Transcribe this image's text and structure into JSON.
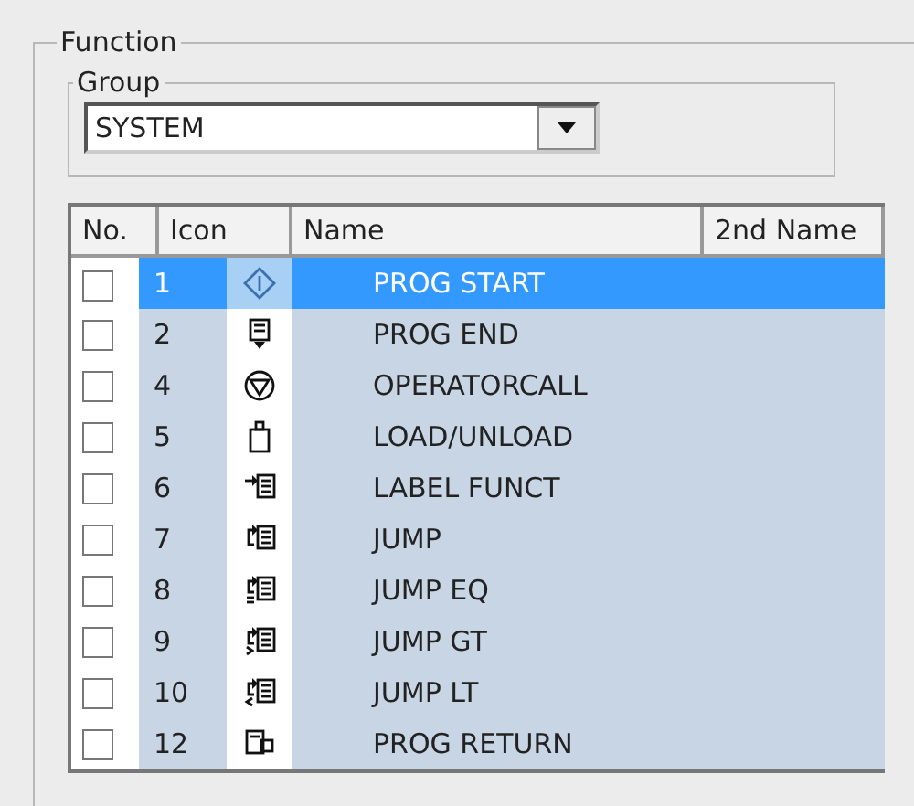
{
  "function_group": {
    "title": "Function"
  },
  "group": {
    "title": "Group",
    "value": "SYSTEM"
  },
  "table": {
    "columns": [
      "No.",
      "Icon",
      "Name",
      "2nd Name"
    ],
    "rows": [
      {
        "checked": false,
        "selected": true,
        "no": "1",
        "name": "PROG START"
      },
      {
        "checked": false,
        "selected": false,
        "no": "2",
        "name": "PROG END"
      },
      {
        "checked": false,
        "selected": false,
        "no": "4",
        "name": "OPERATORCALL"
      },
      {
        "checked": false,
        "selected": false,
        "no": "5",
        "name": "LOAD/UNLOAD"
      },
      {
        "checked": false,
        "selected": false,
        "no": "6",
        "name": "LABEL FUNCT"
      },
      {
        "checked": false,
        "selected": false,
        "no": "7",
        "name": "JUMP"
      },
      {
        "checked": false,
        "selected": false,
        "no": "8",
        "name": "JUMP EQ"
      },
      {
        "checked": false,
        "selected": false,
        "no": "9",
        "name": "JUMP GT"
      },
      {
        "checked": false,
        "selected": false,
        "no": "10",
        "name": "JUMP LT"
      },
      {
        "checked": false,
        "selected": false,
        "no": "12",
        "name": "PROG RETURN"
      }
    ]
  }
}
